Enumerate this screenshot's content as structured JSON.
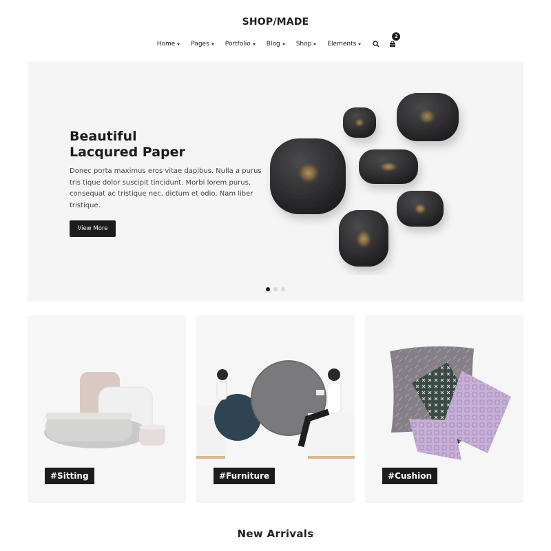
{
  "header": {
    "logo": "SHOP/MADE",
    "nav": [
      "Home",
      "Pages",
      "Portfolio",
      "Blog",
      "Shop",
      "Elements"
    ],
    "search_icon": "search-icon",
    "cart_icon": "cart-icon",
    "cart_count": "2"
  },
  "hero": {
    "title_line1": "Beautiful",
    "title_line2": "Lacqured Paper",
    "text": "Donec porta maximus eros vitae dapibus. Nulla a purus tris tique dolor suscipit tincidunt. Morbi lorem purus, consequat ac tristique nec, dictum et odio. Nam liber tristique.",
    "button": "View More",
    "slide_count": 3,
    "active_slide": 1
  },
  "categories": [
    {
      "tag": "#Sitting"
    },
    {
      "tag": "#Furniture"
    },
    {
      "tag": "#Cushion"
    }
  ],
  "sections": {
    "new_arrivals": "New Arrivals"
  }
}
